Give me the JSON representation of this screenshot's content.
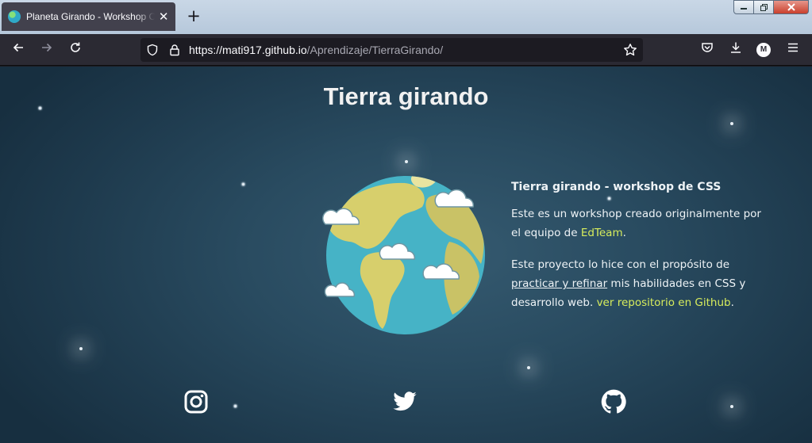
{
  "browser": {
    "tab_title": "Planeta Girando - Workshop CSS",
    "tab_close": "✕",
    "new_tab": "+",
    "url_host": "https://mati917.github.io",
    "url_path": "/Aprendizaje/TierraGirando/",
    "account_initial": "M"
  },
  "page": {
    "title": "Tierra girando",
    "info": {
      "heading": "Tierra girando - workshop de CSS",
      "p1_before": "Este es un workshop creado originalmente por el equipo de ",
      "p1_link": "EdTeam",
      "p1_after": ".",
      "p2_before": "Este proyecto lo hice con el propósito de ",
      "p2_emphasis": "practicar y refinar",
      "p2_middle": " mis habilidades en CSS y desarrollo web. ",
      "p2_link": "ver repositorio en Github",
      "p2_after": "."
    },
    "social": [
      "instagram-icon",
      "twitter-icon",
      "github-icon"
    ]
  },
  "colors": {
    "accent_link": "#d7ec5c",
    "page_bg": "#294b60",
    "ocean": "#46b3c6",
    "land": "#d7cf6c"
  }
}
